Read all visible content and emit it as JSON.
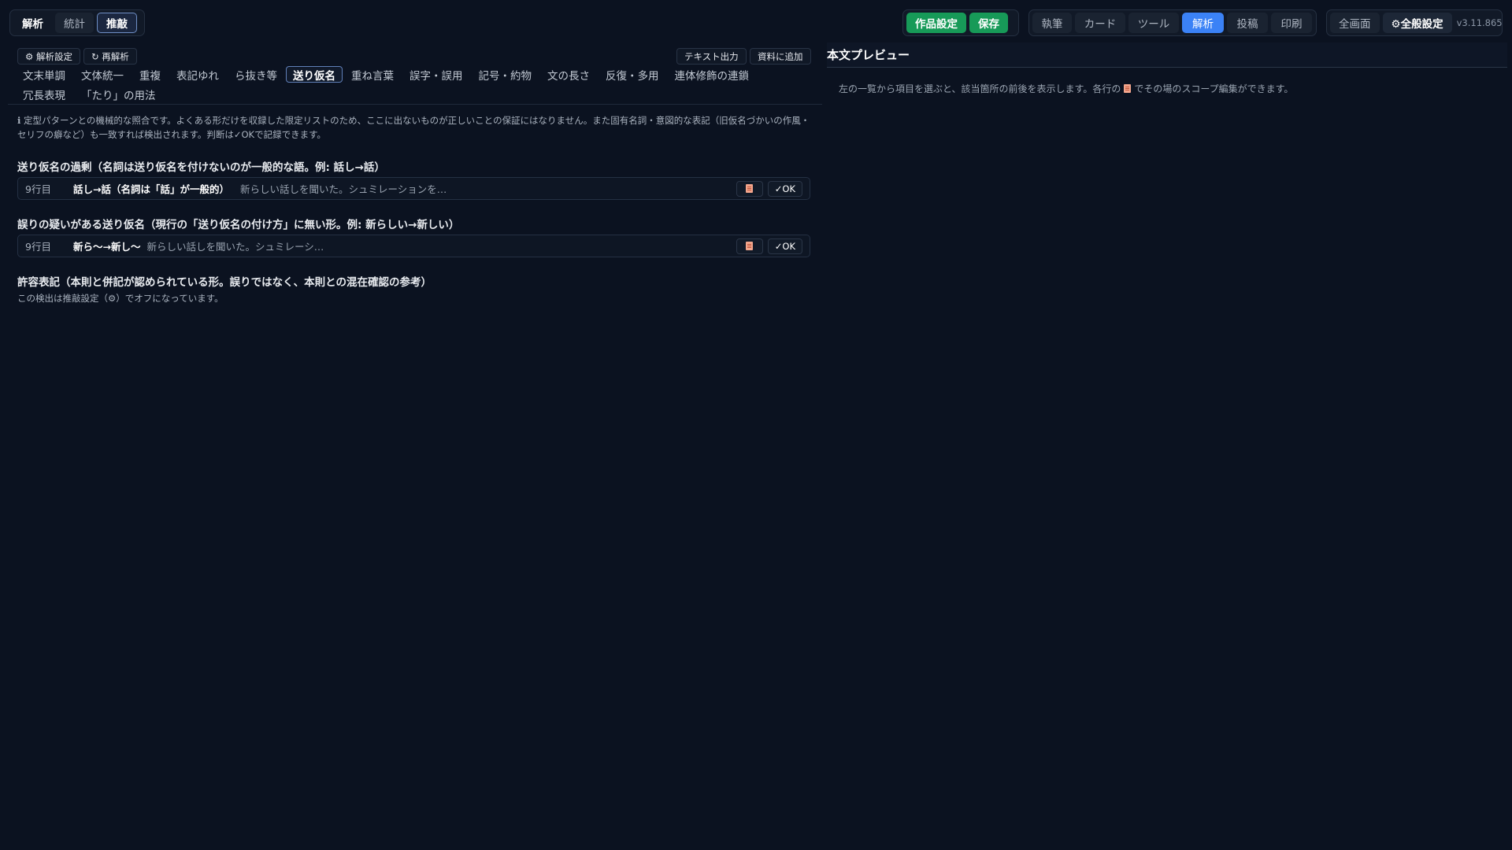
{
  "topbar": {
    "mode_tabs": [
      "解析",
      "統計",
      "推敲"
    ],
    "project_buttons": {
      "settings": "作品設定",
      "save": "保存"
    },
    "views": [
      "執筆",
      "カード",
      "ツール",
      "解析",
      "投稿",
      "印刷"
    ],
    "fullscreen": "全画面",
    "global_settings": "⚙全般設定",
    "version": "v3.11.865"
  },
  "left": {
    "analysis_settings": "⚙ 解析設定",
    "reanalyze": "↻ 再解析",
    "text_export": "テキスト出力",
    "add_to_material": "資料に追加",
    "tabs": [
      "文末単調",
      "文体統一",
      "重複",
      "表記ゆれ",
      "ら抜き等",
      "送り仮名",
      "重ね言葉",
      "誤字・誤用",
      "記号・約物",
      "文の長さ",
      "反復・多用",
      "連体修飾の連鎖",
      "冗長表現",
      "「たり」の用法"
    ],
    "active_tab": "送り仮名",
    "note": "ℹ 定型パターンとの機械的な照合です。よくある形だけを収録した限定リストのため、ここに出ないものが正しいことの保証にはなりません。また固有名詞・意図的な表記（旧仮名づかいの作風・セリフの癖など）も一致すれば検出されます。判断は✓OKで記録できます。",
    "sections": [
      {
        "title": "送り仮名の過剰（名詞は送り仮名を付けないのが一般的な語。例: 話し→話）",
        "rows": [
          {
            "line": "9行目",
            "pattern": "話し→話（名詞は「話」が一般的）",
            "context": "新らしい話しを聞いた。シュミレーションを…",
            "ok": "✓OK"
          }
        ]
      },
      {
        "title": "誤りの疑いがある送り仮名（現行の「送り仮名の付け方」に無い形。例: 新らしい→新しい）",
        "rows": [
          {
            "line": "9行目",
            "pattern": "新ら〜→新し〜",
            "context": "新らしい話しを聞いた。シュミレーシ…",
            "ok": "✓OK"
          }
        ]
      },
      {
        "title": "許容表記（本則と併記が認められている形。誤りではなく、本則との混在確認の参考）",
        "off_note": "この検出は推敲設定（⚙）でオフになっています。"
      }
    ]
  },
  "preview": {
    "title": "本文プレビュー",
    "help_before": "左の一覧から項目を選ぶと、該当箇所の前後を表示します。各行の",
    "help_after": "でその場のスコープ編集ができます。"
  }
}
